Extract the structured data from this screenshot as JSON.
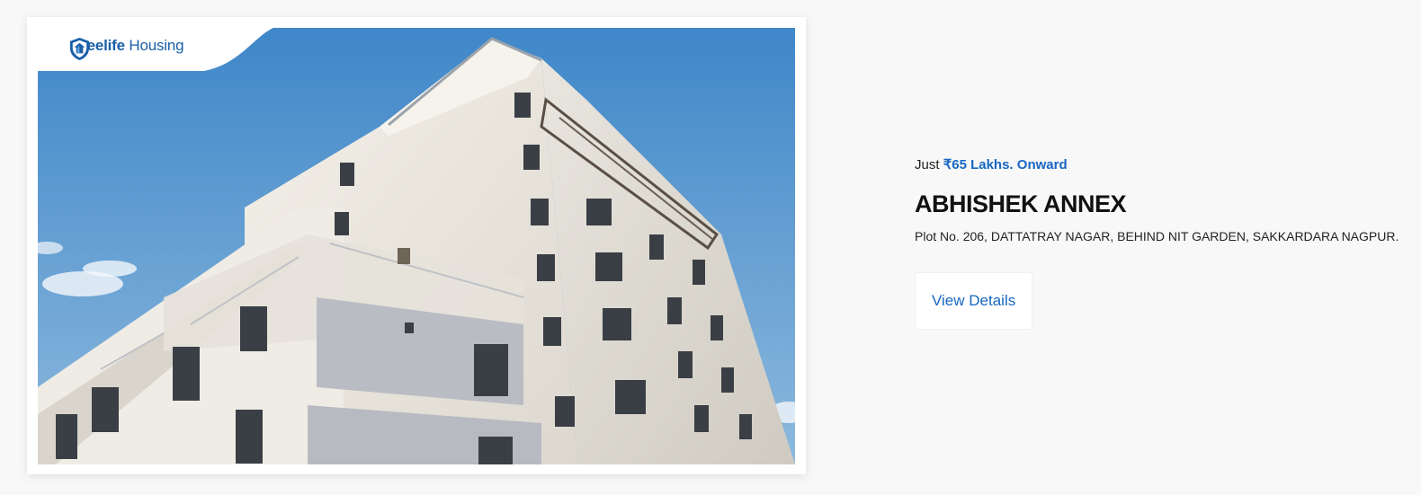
{
  "brand": {
    "name_part1": "Freelife",
    "name_part2": " Housing",
    "icon": "shield-house-icon",
    "color": "#1a5fa8"
  },
  "property": {
    "image": "building-photo",
    "price_prefix": "Just ",
    "price_amount": "₹65 Lakhs. Onward",
    "name": "ABHISHEK ANNEX",
    "address": "Plot No. 206, DATTATRAY NAGAR, BEHIND NIT GARDEN, SAKKARDARA NAGPUR.",
    "cta_label": "View Details"
  },
  "colors": {
    "accent": "#1766c2",
    "background": "#f8f8f8"
  }
}
